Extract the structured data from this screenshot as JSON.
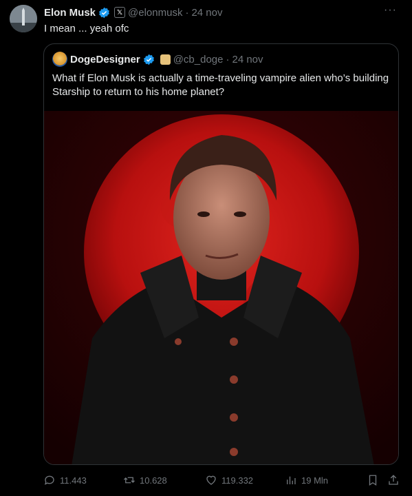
{
  "post": {
    "author_name": "Elon Musk",
    "handle": "@elonmusk",
    "date": "24 nov",
    "separator": "·",
    "text": "I mean ... yeah ofc",
    "more_label": "···"
  },
  "quote": {
    "author_name": "DogeDesigner",
    "handle": "@cb_doge",
    "date": "24 nov",
    "separator": "·",
    "text": "What if Elon Musk is actually a time-traveling vampire alien who’s building Starship to return to his home planet?"
  },
  "actions": {
    "replies": "11.443",
    "reposts": "10.628",
    "likes": "119.332",
    "views": "19 Mln"
  },
  "colors": {
    "accent": "#1d9bf0",
    "muted": "#71767b",
    "text": "#e7e9ea",
    "background": "#000000",
    "moon_red": "#c8141a"
  }
}
